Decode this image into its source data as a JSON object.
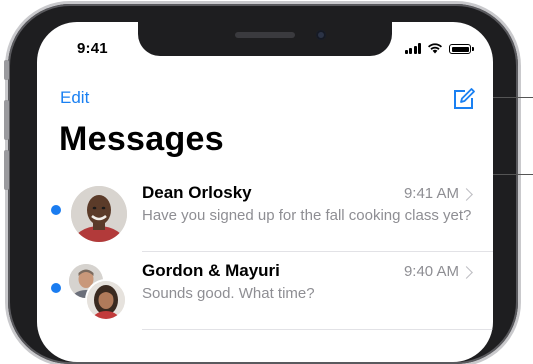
{
  "status_bar": {
    "time": "9:41"
  },
  "nav": {
    "edit_label": "Edit",
    "compose_icon": "compose-icon"
  },
  "page_title": "Messages",
  "conversations": [
    {
      "name": "Dean Orlosky",
      "time": "9:41 AM",
      "preview": "Have you signed up for the fall cooking class yet?",
      "unread": true
    },
    {
      "name": "Gordon & Mayuri",
      "time": "9:40 AM",
      "preview": "Sounds good. What time?",
      "unread": true
    }
  ],
  "colors": {
    "accent": "#1a80f2",
    "unread_dot": "#1a7cf0",
    "secondary_text": "#8e8e93"
  }
}
